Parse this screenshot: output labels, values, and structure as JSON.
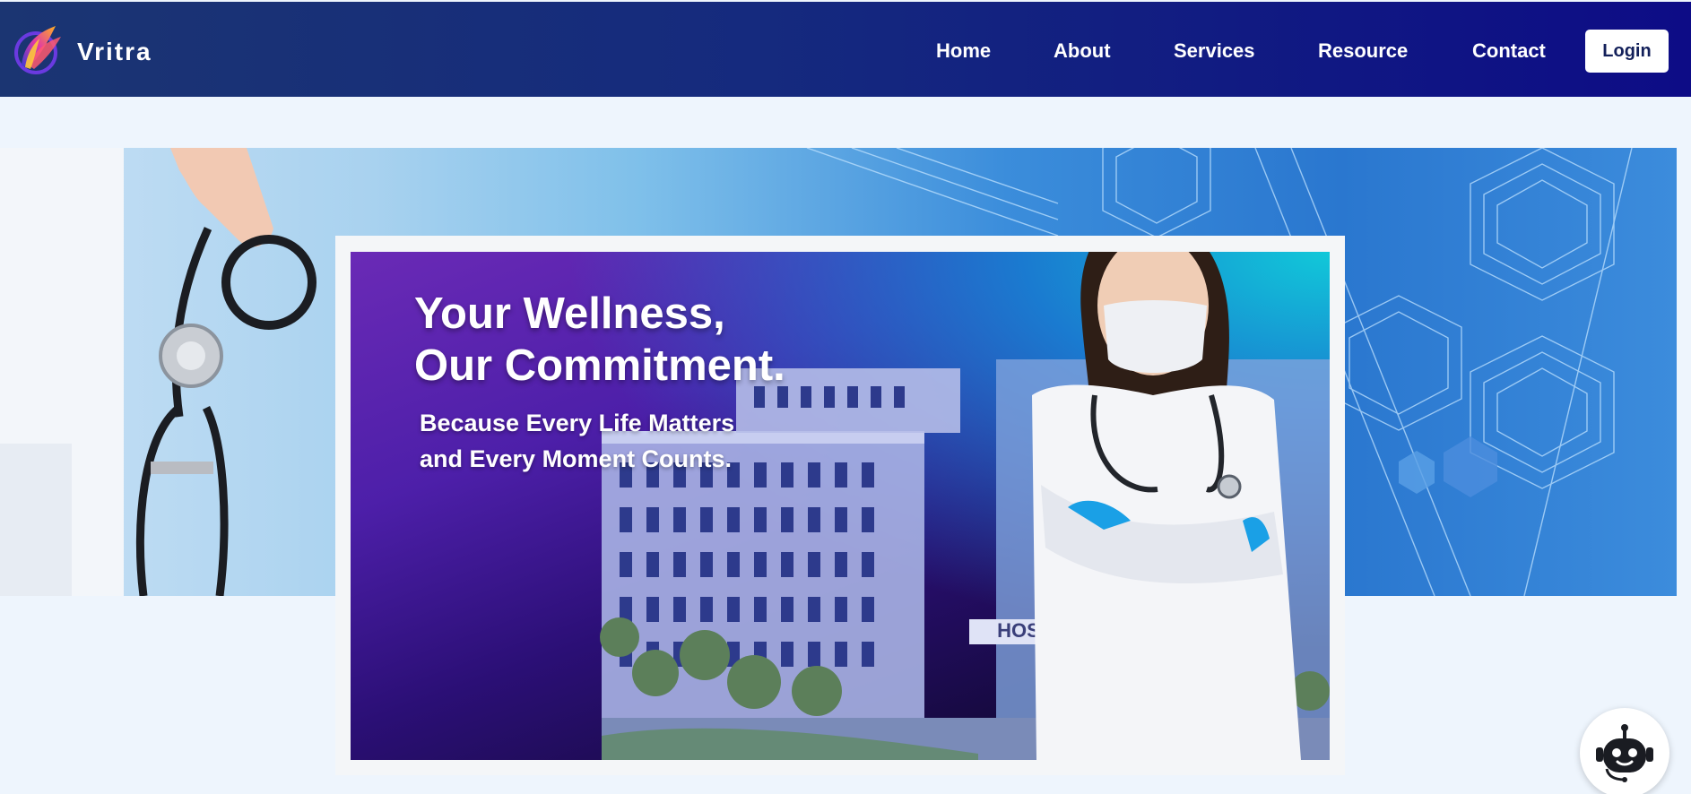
{
  "header": {
    "brand_name": "Vritra",
    "nav": [
      "Home",
      "About",
      "Services",
      "Resource",
      "Contact"
    ],
    "login_label": "Login"
  },
  "hero": {
    "headline": [
      "Your Wellness,",
      "Our Commitment."
    ],
    "subline": [
      "Because Every Life Matters",
      "and Every Moment Counts."
    ],
    "building_sign": "HOS"
  },
  "icons": {
    "logo": "vritra-feather-logo",
    "chatbot": "robot-icon"
  },
  "colors": {
    "nav_start": "#1b3572",
    "nav_end": "#0d0c86",
    "page_bg": "#eef5fd",
    "card_purple": "#4d1fa9",
    "card_teal": "#11c8d9"
  }
}
